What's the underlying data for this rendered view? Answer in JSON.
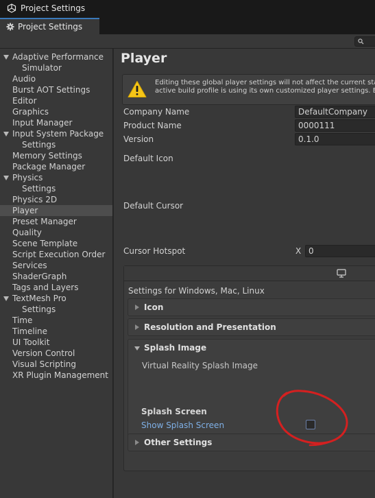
{
  "window": {
    "title": "Project Settings",
    "tab_label": "Project Settings"
  },
  "sidebar": {
    "items": [
      {
        "label": "Adaptive Performance",
        "expanded": true
      },
      {
        "label": "Simulator"
      },
      {
        "label": "Audio"
      },
      {
        "label": "Burst AOT Settings"
      },
      {
        "label": "Editor"
      },
      {
        "label": "Graphics"
      },
      {
        "label": "Input Manager"
      },
      {
        "label": "Input System Package",
        "expanded": true
      },
      {
        "label": "Settings"
      },
      {
        "label": "Memory Settings"
      },
      {
        "label": "Package Manager"
      },
      {
        "label": "Physics",
        "expanded": true
      },
      {
        "label": "Settings"
      },
      {
        "label": "Physics 2D"
      },
      {
        "label": "Player",
        "selected": true
      },
      {
        "label": "Preset Manager"
      },
      {
        "label": "Quality"
      },
      {
        "label": "Scene Template"
      },
      {
        "label": "Script Execution Order"
      },
      {
        "label": "Services"
      },
      {
        "label": "ShaderGraph"
      },
      {
        "label": "Tags and Layers"
      },
      {
        "label": "TextMesh Pro",
        "expanded": true
      },
      {
        "label": "Settings"
      },
      {
        "label": "Time"
      },
      {
        "label": "Timeline"
      },
      {
        "label": "UI Toolkit"
      },
      {
        "label": "Version Control"
      },
      {
        "label": "Visual Scripting"
      },
      {
        "label": "XR Plugin Management"
      }
    ]
  },
  "main": {
    "title": "Player",
    "warning": {
      "line1": "Editing these global player settings will not affect the current state o",
      "line2": "active build profile is using its own customized player settings. Edit t"
    },
    "company_name": {
      "label": "Company Name",
      "value": "DefaultCompany"
    },
    "product_name": {
      "label": "Product Name",
      "value": "0000111"
    },
    "version": {
      "label": "Version",
      "value": "0.1.0"
    },
    "default_icon_label": "Default Icon",
    "default_cursor_label": "Default Cursor",
    "cursor_hotspot": {
      "label": "Cursor Hotspot",
      "x_label": "X",
      "x_value": "0"
    },
    "platform": {
      "heading": "Settings for Windows, Mac, Linux",
      "sections": {
        "icon": "Icon",
        "resolution": "Resolution and Presentation",
        "splash": "Splash Image",
        "other": "Other Settings"
      },
      "vr_splash_label": "Virtual Reality Splash Image",
      "splash_screen_heading": "Splash Screen",
      "show_splash_label": "Show Splash Screen",
      "show_splash_checked": false
    }
  },
  "colors": {
    "background": "#383838",
    "selected_row": "#4d4d4d",
    "accent_tab": "#3a79bb",
    "link_text": "#7fb0e6",
    "annotation": "#d42020",
    "warning_icon": "#f5c518"
  }
}
